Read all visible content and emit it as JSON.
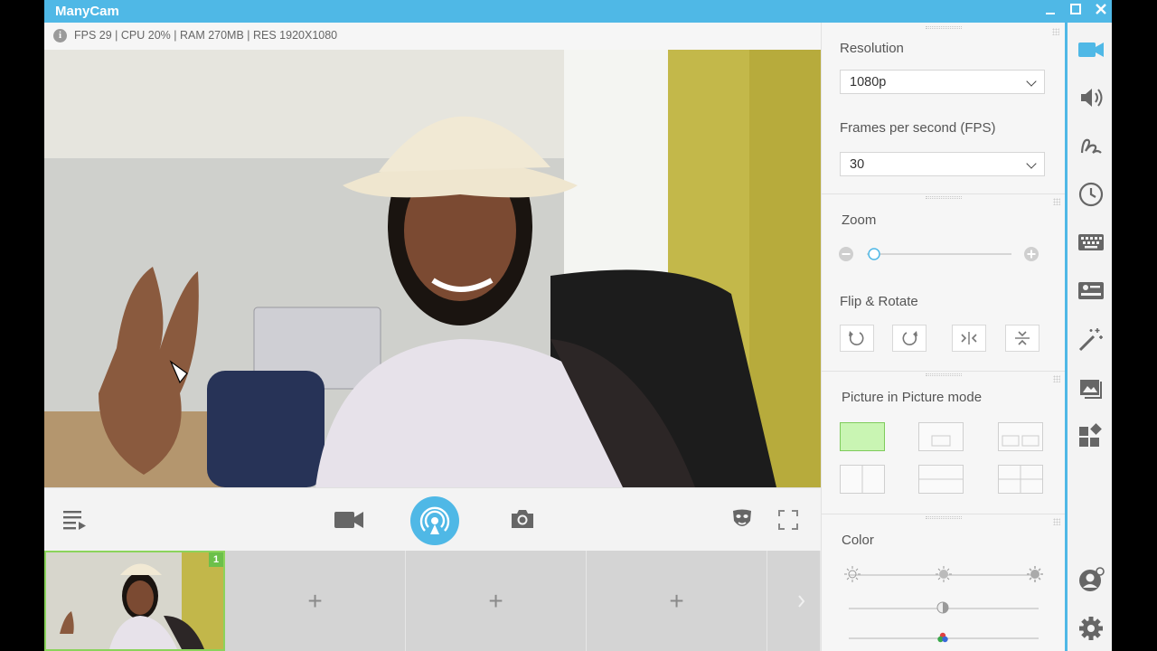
{
  "app": {
    "title": "ManyCam"
  },
  "window_controls": {
    "minimize": "—",
    "maximize": "☐",
    "close": "✕"
  },
  "status": {
    "info_glyph": "i",
    "text": "FPS 29 | CPU 20% | RAM 270MB | RES 1920X1080"
  },
  "source_slots": [
    {
      "number": "1",
      "active": true
    },
    {
      "plus": "+"
    },
    {
      "plus": "+"
    },
    {
      "plus": "+"
    }
  ],
  "settings": {
    "resolution": {
      "title": "Resolution",
      "value": "1080p"
    },
    "fps": {
      "title": "Frames per second (FPS)",
      "value": "30"
    },
    "zoom": {
      "title": "Zoom",
      "level": 0
    },
    "flip_rotate": {
      "title": "Flip & Rotate"
    },
    "pip": {
      "title": "Picture in Picture mode"
    },
    "color": {
      "title": "Color"
    }
  },
  "colors": {
    "accent": "#4fb8e6",
    "active_green": "#6cc04a",
    "pip_selected": "#c9f5b3"
  },
  "icons": {
    "sidebar": [
      "video-camera-icon",
      "speaker-icon",
      "drawing-icon",
      "clock-icon",
      "keyboard-icon",
      "lower-thirds-icon",
      "magic-wand-icon",
      "image-icon",
      "widgets-icon",
      "account-icon",
      "settings-icon"
    ],
    "toolbar": [
      "playlist-icon",
      "video-record-icon",
      "broadcast-icon",
      "snapshot-icon",
      "face-mask-icon",
      "fullscreen-icon"
    ]
  }
}
